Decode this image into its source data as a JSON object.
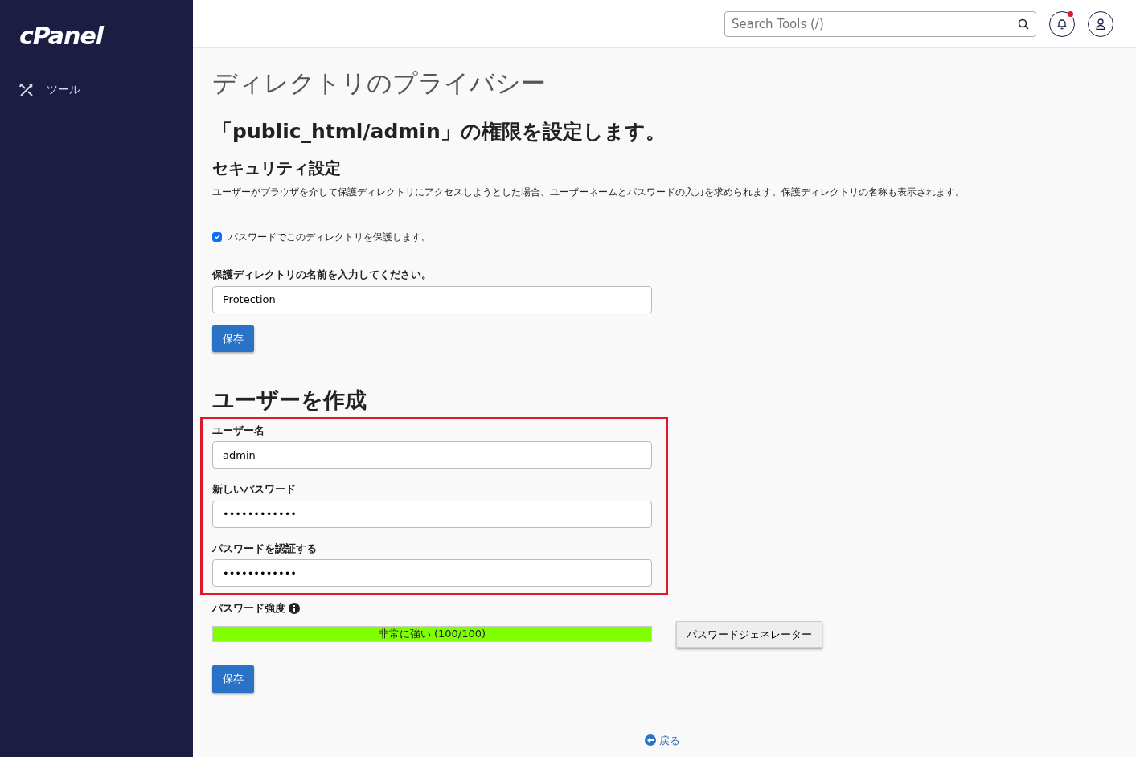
{
  "sidebar": {
    "logo": "cPanel",
    "items": [
      {
        "label": "ツール",
        "selected": false
      }
    ]
  },
  "header": {
    "search": {
      "placeholder": "Search Tools (/)"
    },
    "has_notification": true
  },
  "page_title": "ディレクトリのプライバシー",
  "subtitle": "「public_html/admin」の権限を設定します。",
  "security": {
    "heading": "セキュリティ設定",
    "description": "ユーザーがブラウザを介して保護ディレクトリにアクセスしようとした場合、ユーザーネームとパスワードの入力を求められます。保護ディレクトリの名称も表示されます。",
    "protect": {
      "label": "パスワードでこのディレクトリを保護します。",
      "checked": true
    },
    "name_label": "保護ディレクトリの名前を入力してください。",
    "name_value": "Protection",
    "save": "保存"
  },
  "create_user": {
    "heading": "ユーザーを作成",
    "highlighted": true,
    "fields": [
      {
        "label": "ユーザー名",
        "value": "admin"
      },
      {
        "label": "新しいパスワード",
        "value": "••••••••••••"
      },
      {
        "label": "パスワードを認証する",
        "value": "••••••••••••"
      }
    ],
    "strength_label": "パスワード強度",
    "strength": {
      "level": 1,
      "text": "非常に強い (100/100)"
    },
    "generator": "パスワードジェネレーター",
    "save": "保存"
  },
  "back_link": "戻る"
}
